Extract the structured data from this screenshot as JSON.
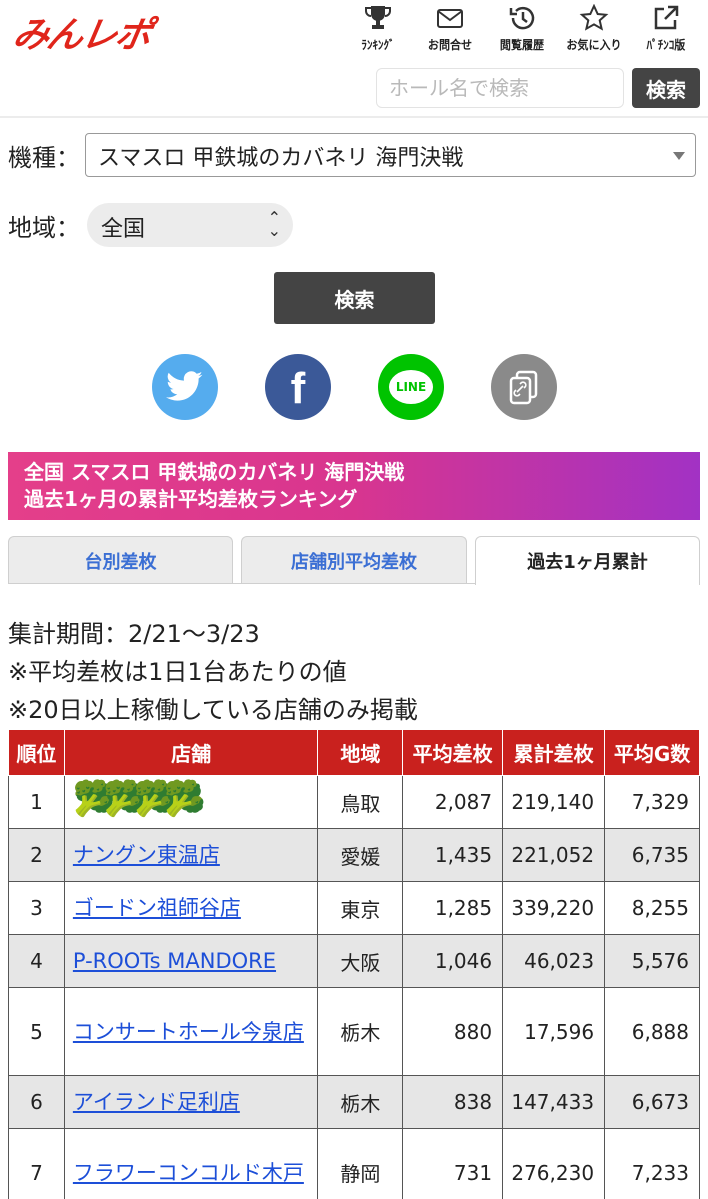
{
  "header": {
    "logo_main": "みんレポ",
    "nav": [
      {
        "icon": "trophy-icon",
        "label": "ﾗﾝｷﾝｸﾞ"
      },
      {
        "icon": "mail-icon",
        "label": "お問合せ"
      },
      {
        "icon": "history-icon",
        "label": "閲覧履歴"
      },
      {
        "icon": "star-icon",
        "label": "お気に入り"
      },
      {
        "icon": "external-link-icon",
        "label": "ﾊﾟﾁﾝｺ版"
      }
    ],
    "search_placeholder": "ホール名で検索",
    "search_button": "検索"
  },
  "filter": {
    "machine_label": "機種：",
    "machine_value": "スマスロ 甲鉄城のカバネリ 海門決戦",
    "region_label": "地域：",
    "region_value": "全国",
    "search_button": "検索"
  },
  "share": {
    "twitter": "twitter-icon",
    "facebook": "facebook-icon",
    "line": "LINE",
    "copy": "copy-link-icon",
    "colors": {
      "twitter": "#55acee",
      "facebook": "#3b5998",
      "line": "#00c300",
      "copy": "#8a8a8a"
    }
  },
  "banner": {
    "line1": "全国 スマスロ 甲鉄城のカバネリ 海門決戦",
    "line2": "過去1ヶ月の累計平均差枚ランキング"
  },
  "tabs": [
    {
      "label": "台別差枚",
      "active": false
    },
    {
      "label": "店舗別平均差枚",
      "active": false
    },
    {
      "label": "過去1ヶ月累計",
      "active": true
    }
  ],
  "info": {
    "period": "集計期間：2/21〜3/23",
    "note1": "※平均差枚は1日1台あたりの値",
    "note2": "※20日以上稼働している店舗のみ掲載"
  },
  "table": {
    "headers": [
      "順位",
      "店舗",
      "地域",
      "平均差枚",
      "累計差枚",
      "平均G数"
    ],
    "rows": [
      {
        "rank": "1",
        "shop": "",
        "shop_obscured": "🥦🥦🥦🥦",
        "region": "鳥取",
        "avg": "2,087",
        "total": "219,140",
        "games": "7,329"
      },
      {
        "rank": "2",
        "shop": "ナングン東温店",
        "region": "愛媛",
        "avg": "1,435",
        "total": "221,052",
        "games": "6,735"
      },
      {
        "rank": "3",
        "shop": "ゴードン祖師谷店",
        "region": "東京",
        "avg": "1,285",
        "total": "339,220",
        "games": "8,255"
      },
      {
        "rank": "4",
        "shop": "P-ROOTs MANDORE",
        "region": "大阪",
        "avg": "1,046",
        "total": "46,023",
        "games": "5,576"
      },
      {
        "rank": "5",
        "shop": "コンサートホール今泉店",
        "region": "栃木",
        "avg": "880",
        "total": "17,596",
        "games": "6,888"
      },
      {
        "rank": "6",
        "shop": "アイランド足利店",
        "region": "栃木",
        "avg": "838",
        "total": "147,433",
        "games": "6,673"
      },
      {
        "rank": "7",
        "shop": "フラワーコンコルド木戸",
        "region": "静岡",
        "avg": "731",
        "total": "276,230",
        "games": "7,233"
      }
    ]
  }
}
